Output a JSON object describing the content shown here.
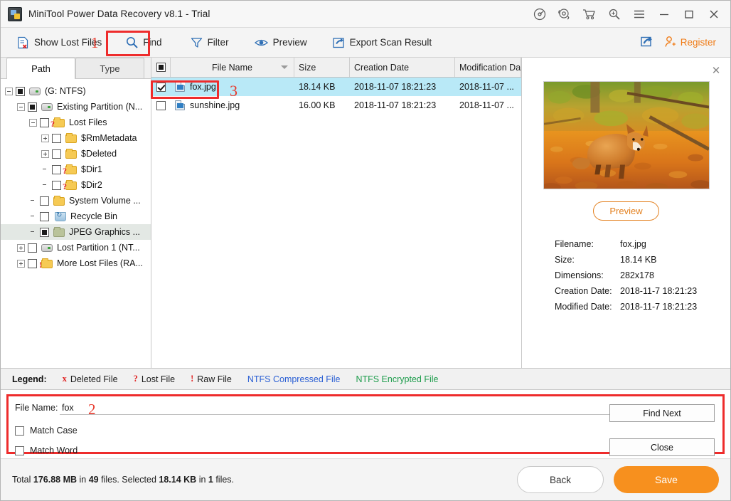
{
  "window": {
    "title": "MiniTool Power Data Recovery v8.1 - Trial",
    "app_icon": "disk-recovery-icon",
    "controls": [
      {
        "name": "disc-icon",
        "glyph": "disc"
      },
      {
        "name": "support-headset-icon",
        "glyph": "headset"
      },
      {
        "name": "shopping-cart-icon",
        "glyph": "cart"
      },
      {
        "name": "zoom-search-icon",
        "glyph": "zoom"
      },
      {
        "name": "menu-hamburger-icon",
        "glyph": "menu"
      },
      {
        "name": "minimize-button",
        "glyph": "minimize"
      },
      {
        "name": "maximize-button",
        "glyph": "maximize"
      },
      {
        "name": "close-button",
        "glyph": "close"
      }
    ]
  },
  "toolbar": {
    "show_lost_files": "Show Lost Files",
    "find": "Find",
    "filter": "Filter",
    "preview": "Preview",
    "export_scan_result": "Export Scan Result",
    "register": "Register",
    "share_icon": "share-icon"
  },
  "annotations": [
    {
      "name": "annotation-1",
      "label": "1"
    },
    {
      "name": "annotation-2",
      "label": "2"
    },
    {
      "name": "annotation-3",
      "label": "3"
    }
  ],
  "tabs": [
    {
      "label": "Path",
      "active": true
    },
    {
      "label": "Type",
      "active": false
    }
  ],
  "tree": [
    {
      "label": "(G: NTFS)",
      "indent": 0,
      "expander": "minus",
      "check": "partial",
      "icon": "drive",
      "mark": "",
      "selected": false
    },
    {
      "label": "Existing Partition (N...",
      "indent": 1,
      "expander": "minus",
      "check": "partial",
      "icon": "drive",
      "mark": "",
      "selected": false
    },
    {
      "label": "Lost Files",
      "indent": 2,
      "expander": "minus",
      "check": "empty",
      "icon": "folder",
      "mark": "?",
      "selected": false
    },
    {
      "label": "$RmMetadata",
      "indent": 3,
      "expander": "plus",
      "check": "empty",
      "icon": "folder",
      "mark": "",
      "selected": false
    },
    {
      "label": "$Deleted",
      "indent": 3,
      "expander": "plus",
      "check": "empty",
      "icon": "folder",
      "mark": "",
      "selected": false
    },
    {
      "label": "$Dir1",
      "indent": 3,
      "expander": "none",
      "check": "empty",
      "icon": "folder",
      "mark": "?",
      "selected": false
    },
    {
      "label": "$Dir2",
      "indent": 3,
      "expander": "none",
      "check": "empty",
      "icon": "folder",
      "mark": "?",
      "selected": false
    },
    {
      "label": "System Volume ...",
      "indent": 2,
      "expander": "none",
      "check": "empty",
      "icon": "folder",
      "mark": "",
      "selected": false
    },
    {
      "label": "Recycle Bin",
      "indent": 2,
      "expander": "none",
      "check": "empty",
      "icon": "recycle",
      "mark": "",
      "selected": false
    },
    {
      "label": "JPEG Graphics ...",
      "indent": 2,
      "expander": "none",
      "check": "partial",
      "icon": "folder-green",
      "mark": "",
      "selected": true
    },
    {
      "label": "Lost Partition 1 (NT...",
      "indent": 1,
      "expander": "plus",
      "check": "empty",
      "icon": "drive",
      "mark": "",
      "selected": false
    },
    {
      "label": "More Lost Files (RA...",
      "indent": 1,
      "expander": "plus",
      "check": "empty",
      "icon": "folder",
      "mark": "!",
      "selected": false
    }
  ],
  "file_list": {
    "columns": [
      "File Name",
      "Size",
      "Creation Date",
      "Modification Dat"
    ],
    "sort_column": "File Name",
    "sort_direction": "descending",
    "rows": [
      {
        "name": "fox.jpg",
        "size": "18.14 KB",
        "creation_date": "2018-11-07 18:21:23",
        "modification_date": "2018-11-07 ...",
        "checked": true,
        "selected": true
      },
      {
        "name": "sunshine.jpg",
        "size": "16.00 KB",
        "creation_date": "2018-11-07 18:21:23",
        "modification_date": "2018-11-07 ...",
        "checked": false,
        "selected": false
      }
    ]
  },
  "preview": {
    "close_icon": "close-icon",
    "image_alt": "fox-photo",
    "button_label": "Preview",
    "details": [
      {
        "key": "Filename:",
        "value": "fox.jpg"
      },
      {
        "key": "Size:",
        "value": "18.14 KB"
      },
      {
        "key": "Dimensions:",
        "value": "282x178"
      },
      {
        "key": "Creation Date:",
        "value": "2018-11-7 18:21:23"
      },
      {
        "key": "Modified Date:",
        "value": "2018-11-7 18:21:23"
      }
    ]
  },
  "legend": {
    "title": "Legend:",
    "items": [
      {
        "symbol": "x",
        "label": "Deleted File",
        "color": "#1b1b1b"
      },
      {
        "symbol": "?",
        "label": "Lost File",
        "color": "#1b1b1b"
      },
      {
        "symbol": "!",
        "label": "Raw File",
        "color": "#1b1b1b"
      },
      {
        "symbol": "",
        "label": "NTFS Compressed File",
        "color": "#2a5fd4"
      },
      {
        "symbol": "",
        "label": "NTFS Encrypted File",
        "color": "#1f9d4d"
      }
    ]
  },
  "find_panel": {
    "file_name_label": "File Name:",
    "file_name_value": "fox",
    "file_name_placeholder": "",
    "match_case": "Match Case",
    "match_word": "Match Word",
    "find_next": "Find Next",
    "close": "Close"
  },
  "statusbar": {
    "text_parts": {
      "prefix": "Total ",
      "total_size": "176.88 MB",
      "mid1": " in ",
      "total_files": "49",
      "mid2": " files.  Selected ",
      "selected_size": "18.14 KB",
      "mid3": " in ",
      "selected_files": "1",
      "suffix": " files."
    },
    "full_text": "Total 176.88 MB in 49 files.  Selected 18.14 KB in 1 files.",
    "back": "Back",
    "save": "Save"
  },
  "colors": {
    "accent_orange": "#f7901e",
    "register_orange": "#f07c17",
    "selection_cyan": "#b9e9f7",
    "annotation_red": "#ee2c2c",
    "link_blue": "#2a5fd4",
    "encrypted_green": "#1f9d4d"
  }
}
